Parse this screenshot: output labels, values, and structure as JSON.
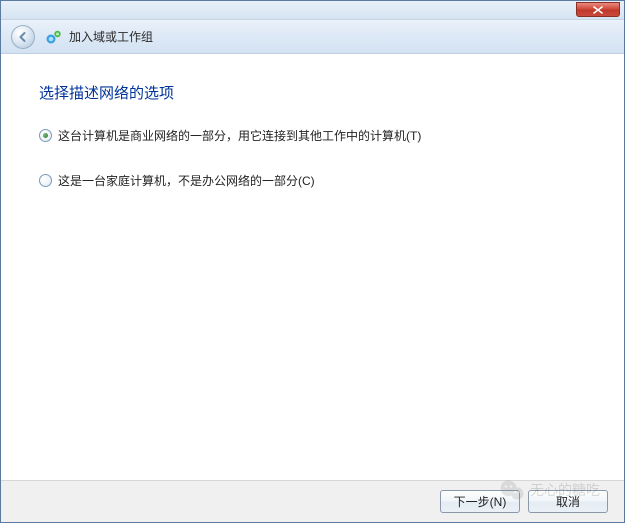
{
  "header": {
    "title": "加入域或工作组"
  },
  "heading": "选择描述网络的选项",
  "options": [
    {
      "label": "这台计算机是商业网络的一部分，用它连接到其他工作中的计算机(T)",
      "selected": true
    },
    {
      "label": "这是一台家庭计算机，不是办公网络的一部分(C)",
      "selected": false
    }
  ],
  "footer": {
    "next": "下一步(N)",
    "cancel": "取消"
  },
  "watermark": "无心的糖吃"
}
